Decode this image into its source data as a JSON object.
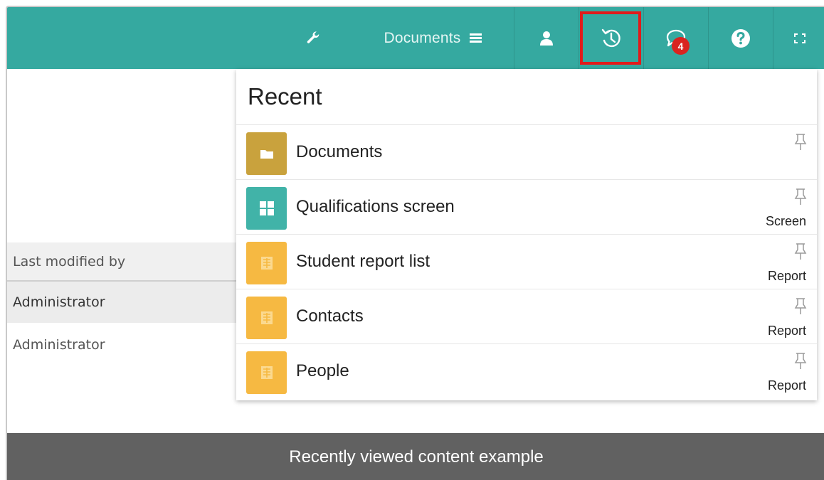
{
  "topbar": {
    "documents_label": "Documents",
    "notification_count": "4",
    "bg_color": "#35a9a0"
  },
  "background_table": {
    "header": "Last modified by",
    "rows": [
      "Administrator",
      "Administrator"
    ]
  },
  "recent_panel": {
    "title": "Recent",
    "items": [
      {
        "label": "Documents",
        "type": "",
        "icon": "folder-icon",
        "color": "#c9a23d"
      },
      {
        "label": "Qualifications screen",
        "type": "Screen",
        "icon": "grid-icon",
        "color": "#41b3a8"
      },
      {
        "label": "Student report list",
        "type": "Report",
        "icon": "report-icon",
        "color": "#f6b942"
      },
      {
        "label": "Contacts",
        "type": "Report",
        "icon": "report-icon",
        "color": "#f6b942"
      },
      {
        "label": "People",
        "type": "Report",
        "icon": "report-icon",
        "color": "#f6b942"
      }
    ]
  },
  "caption": "Recently viewed content example"
}
